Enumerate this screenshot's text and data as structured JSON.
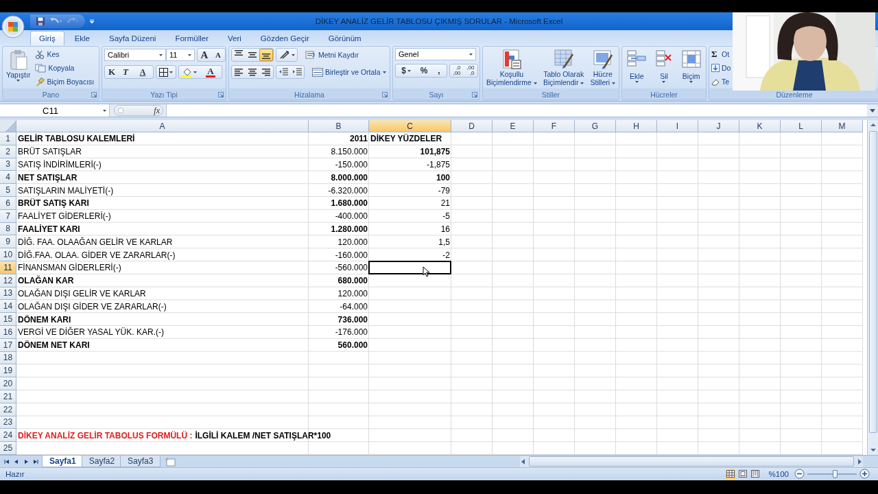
{
  "window": {
    "title": "DİKEY ANALİZ GELİR TABLOSU ÇIKMIŞ SORULAR - Microsoft Excel"
  },
  "tabs": [
    {
      "label": "Giriş",
      "selected": true
    },
    {
      "label": "Ekle",
      "selected": false
    },
    {
      "label": "Sayfa Düzeni",
      "selected": false
    },
    {
      "label": "Formüller",
      "selected": false
    },
    {
      "label": "Veri",
      "selected": false
    },
    {
      "label": "Gözden Geçir",
      "selected": false
    },
    {
      "label": "Görünüm",
      "selected": false
    }
  ],
  "ribbon": {
    "groups": [
      {
        "kind": "clipboard",
        "label": "Pano",
        "paste": "Yapıştır",
        "items": [
          "Kes",
          "Kopyala",
          "Biçim Boyacısı"
        ]
      },
      {
        "kind": "font",
        "label": "Yazı Tipi",
        "font": "Calibri",
        "size": "11",
        "grow": "A",
        "shrink": "A",
        "bold": "K",
        "italic": "T",
        "underline": "A",
        "font_color": "A"
      },
      {
        "kind": "alignment",
        "label": "Hizalama",
        "vertical": [
          {
            "selected": false
          },
          {
            "selected": false
          },
          {
            "selected": true
          }
        ],
        "wrap": "Metni Kaydır",
        "merge": "Birleştir ve Ortala"
      },
      {
        "kind": "number",
        "label": "Sayı",
        "format": "Genel",
        "buttons": [
          "$",
          "%",
          ","
        ],
        "decimals": [
          [
            ",0",
            ",00"
          ],
          [
            ",00",
            ",0"
          ]
        ]
      },
      {
        "kind": "styles",
        "label": "Stiller",
        "buttons": [
          [
            "Koşullu",
            "Biçimlendirme"
          ],
          [
            "Tablo Olarak",
            "Biçimlendir"
          ],
          [
            "Hücre",
            "Stilleri"
          ]
        ]
      },
      {
        "kind": "cells",
        "label": "Hücreler",
        "buttons": [
          "Ekle",
          "Sil",
          "Biçim"
        ]
      },
      {
        "kind": "editing",
        "label": "Düzenleme",
        "sigma": "Σ",
        "items": [
          "Ot",
          "Do",
          "Te"
        ]
      }
    ]
  },
  "formula_bar": {
    "name_box": "C11",
    "fx": "fx"
  },
  "sheet": {
    "columns": [
      {
        "label": "A",
        "selected": false
      },
      {
        "label": "B",
        "selected": false
      },
      {
        "label": "C",
        "selected": true
      },
      {
        "label": "D",
        "selected": false
      },
      {
        "label": "E",
        "selected": false
      },
      {
        "label": "F",
        "selected": false
      },
      {
        "label": "G",
        "selected": false
      },
      {
        "label": "H",
        "selected": false
      },
      {
        "label": "I",
        "selected": false
      },
      {
        "label": "J",
        "selected": false
      },
      {
        "label": "K",
        "selected": false
      },
      {
        "label": "L",
        "selected": false
      },
      {
        "label": "M",
        "selected": false
      }
    ],
    "rows": [
      {
        "number": "1",
        "selected": false,
        "kind": "header",
        "cells": [
          {
            "text": "GELİR TABLOSU KALEMLERİ",
            "bold": true
          },
          {
            "text": "2011",
            "bold": true
          },
          {
            "text": "DİKEY YÜZDELER",
            "bold": true
          }
        ]
      },
      {
        "number": "2",
        "selected": false,
        "kind": "data",
        "cells": [
          {
            "text": "BRÜT SATIŞLAR",
            "bold": false
          },
          {
            "text": "8.150.000",
            "bold": false
          },
          {
            "text": "101,875",
            "bold": true
          }
        ]
      },
      {
        "number": "3",
        "selected": false,
        "kind": "data",
        "cells": [
          {
            "text": "SATIŞ İNDİRİMLERİ(-)",
            "bold": false
          },
          {
            "text": "-150.000",
            "bold": false
          },
          {
            "text": "-1,875",
            "bold": false
          }
        ]
      },
      {
        "number": "4",
        "selected": false,
        "kind": "data",
        "cells": [
          {
            "text": "NET SATIŞLAR",
            "bold": true
          },
          {
            "text": "8.000.000",
            "bold": true
          },
          {
            "text": "100",
            "bold": true
          }
        ]
      },
      {
        "number": "5",
        "selected": false,
        "kind": "data",
        "cells": [
          {
            "text": "SATIŞLARIN MALİYETİ(-)",
            "bold": false
          },
          {
            "text": "-6.320.000",
            "bold": false
          },
          {
            "text": "-79",
            "bold": false
          }
        ]
      },
      {
        "number": "6",
        "selected": false,
        "kind": "data",
        "cells": [
          {
            "text": "BRÜT SATIŞ KARI",
            "bold": true
          },
          {
            "text": "1.680.000",
            "bold": true
          },
          {
            "text": "21",
            "bold": false
          }
        ]
      },
      {
        "number": "7",
        "selected": false,
        "kind": "data",
        "cells": [
          {
            "text": "FAALİYET GİDERLERİ(-)",
            "bold": false
          },
          {
            "text": "-400.000",
            "bold": false
          },
          {
            "text": "-5",
            "bold": false
          }
        ]
      },
      {
        "number": "8",
        "selected": false,
        "kind": "data",
        "cells": [
          {
            "text": "FAALİYET KARI",
            "bold": true
          },
          {
            "text": "1.280.000",
            "bold": true
          },
          {
            "text": "16",
            "bold": false
          }
        ]
      },
      {
        "number": "9",
        "selected": false,
        "kind": "data",
        "cells": [
          {
            "text": "DİĞ. FAA. OLAAĞAN GELİR VE KARLAR",
            "bold": false
          },
          {
            "text": "120.000",
            "bold": false
          },
          {
            "text": "1,5",
            "bold": false
          }
        ]
      },
      {
        "number": "10",
        "selected": false,
        "kind": "data",
        "cells": [
          {
            "text": "DİĞ.FAA. OLAA. GİDER VE ZARARLAR(-)",
            "bold": false
          },
          {
            "text": "-160.000",
            "bold": false
          },
          {
            "text": "-2",
            "bold": false
          }
        ]
      },
      {
        "number": "11",
        "selected": true,
        "kind": "data",
        "cells": [
          {
            "text": "FİNANSMAN GİDERLERİ(-)",
            "bold": false
          },
          {
            "text": "-560.000",
            "bold": false
          }
        ]
      },
      {
        "number": "12",
        "selected": false,
        "kind": "data",
        "cells": [
          {
            "text": "OLAĞAN KAR",
            "bold": true
          },
          {
            "text": "680.000",
            "bold": true
          }
        ]
      },
      {
        "number": "13",
        "selected": false,
        "kind": "data",
        "cells": [
          {
            "text": "OLAĞAN DIŞI GELİR VE KARLAR",
            "bold": false
          },
          {
            "text": "120.000",
            "bold": false
          }
        ]
      },
      {
        "number": "14",
        "selected": false,
        "kind": "data",
        "cells": [
          {
            "text": "OLAĞAN DIŞI GİDER VE ZARARLAR(-)",
            "bold": false
          },
          {
            "text": "-64.000",
            "bold": false
          }
        ]
      },
      {
        "number": "15",
        "selected": false,
        "kind": "data",
        "cells": [
          {
            "text": "DÖNEM KARI",
            "bold": true
          },
          {
            "text": "736.000",
            "bold": true
          }
        ]
      },
      {
        "number": "16",
        "selected": false,
        "kind": "data",
        "cells": [
          {
            "text": "VERGİ VE DİĞER YASAL YÜK. KAR.(-)",
            "bold": false
          },
          {
            "text": "-176.000",
            "bold": false
          }
        ]
      },
      {
        "number": "17",
        "selected": false,
        "kind": "data",
        "cells": [
          {
            "text": "DÖNEM NET KARI",
            "bold": true
          },
          {
            "text": "560.000",
            "bold": true
          }
        ]
      },
      {
        "number": "18",
        "selected": false,
        "kind": "data"
      },
      {
        "number": "19",
        "selected": false,
        "kind": "data"
      },
      {
        "number": "20",
        "selected": false,
        "kind": "data"
      },
      {
        "number": "21",
        "selected": false,
        "kind": "data"
      },
      {
        "number": "22",
        "selected": false,
        "kind": "data"
      },
      {
        "number": "23",
        "selected": false,
        "kind": "data"
      },
      {
        "number": "24",
        "selected": false,
        "kind": "note",
        "note": {
          "label": "DİKEY ANALİZ GELİR TABOLUS FORMÜLÜ :",
          "text": "İLGİLİ KALEM /NET SATIŞLAR*100"
        }
      },
      {
        "number": "25",
        "selected": false,
        "kind": "data"
      }
    ]
  },
  "sheet_tabs": [
    {
      "label": "Sayfa1",
      "selected": true
    },
    {
      "label": "Sayfa2",
      "selected": false
    },
    {
      "label": "Sayfa3",
      "selected": false
    }
  ],
  "status_bar": {
    "text": "Hazır",
    "views": [
      {
        "selected": true
      },
      {
        "selected": false
      },
      {
        "selected": false
      }
    ],
    "zoom": "%100",
    "zoom_slider": {
      "level": 0.55
    }
  }
}
